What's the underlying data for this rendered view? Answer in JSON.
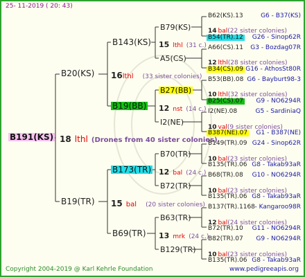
{
  "header": {
    "date": "25- 11-2019 ( 20: 43)"
  },
  "footer": {
    "copyright": "Copyright 2004-2019 @ Karl Kehrle Foundation",
    "site": "www.pedigreeapis.org"
  },
  "colors": {
    "border": "#2ea52e",
    "background": "#fefef0",
    "pink": "#f9c3f2",
    "green": "#12c212",
    "yellow": "#ffff00",
    "cyan": "#22dde8"
  },
  "gen1": {
    "name": "B191(KS)"
  },
  "gen1_mate": {
    "num": "18",
    "abbr": "lthl",
    "note": "(Drones from 40 sister colonies)"
  },
  "gen2": [
    {
      "name": "B20(KS)",
      "num": "16",
      "abbr": "lthl",
      "note": "(33 sister colonies)"
    },
    {
      "name": "B19(TR)",
      "num": "15",
      "abbr": "bal",
      "note": "(20 sister colonies)"
    }
  ],
  "gen3": [
    {
      "name": "B143(KS)",
      "num": "15",
      "abbr": "lthl",
      "note": "(31 c.)"
    },
    {
      "name": "B19(BB)",
      "num": "12",
      "abbr": "nst",
      "note": "(14 c.)"
    },
    {
      "name": "B173(TR)",
      "num": "12",
      "abbr": "bal",
      "note": "(24 c.)"
    },
    {
      "name": "B69(TR)",
      "num": "13",
      "abbr": "mrk",
      "note": "(24 c.)"
    }
  ],
  "gen4": [
    {
      "name": "B79(KS)"
    },
    {
      "name": "A5(CS)"
    },
    {
      "name": "B27(BB)"
    },
    {
      "name": "I2(NE)"
    },
    {
      "name": "B70(TR)"
    },
    {
      "name": "B72(TR)"
    },
    {
      "name": "B63(TR)"
    },
    {
      "name": "B129(TR)"
    }
  ],
  "gen5": [
    {
      "name": "B62(KS).13",
      "code": "G6 - B37(KS)"
    },
    {
      "num": "14",
      "abbr": "bal",
      "note": "(22 sister colonies)"
    },
    {
      "name": "B54(TR).12",
      "code": "G26 - Sinop62R"
    },
    {
      "name": "A66(CS).11",
      "code": "G3 - Bozdag07R"
    },
    {
      "num": "12",
      "abbr": "lthl",
      "note": "(28 sister colonies)"
    },
    {
      "name": "B34(CS).09",
      "code": "G16 - AthosSt80R"
    },
    {
      "name": "B53(BB).08",
      "code": "G6 - Bayburt98-3"
    },
    {
      "num": "10",
      "abbr": "lthl",
      "note": "(32 sister colonies)"
    },
    {
      "name": "B25(CS).07",
      "code": "G9 - NO6294R"
    },
    {
      "name": "I2(NE).08",
      "code": "G5 - SardiniaQ"
    },
    {
      "num": "10",
      "abbr": "val",
      "note": "(9 sister colonies)"
    },
    {
      "name": "B387(NE).07",
      "code": "G1 - B387(NE)"
    },
    {
      "name": "B149(TR).09",
      "code": "G24 - Sinop62R"
    },
    {
      "num": "10",
      "abbr": "bal",
      "note": "(23 sister colonies)"
    },
    {
      "name": "B135(TR).06",
      "code": "G8 - Takab93aR"
    },
    {
      "name": "B68(TR).08",
      "code": "G10 - NO6294R"
    },
    {
      "num": "10",
      "abbr": "bal",
      "note": "(23 sister colonies)"
    },
    {
      "name": "B135(TR).06",
      "code": "G8 - Takab93aR"
    },
    {
      "name": "B137(TR).1168",
      "code": "- Kangaroo98R"
    },
    {
      "num": "12",
      "abbr": "bal",
      "note": "(24 sister colonies)"
    },
    {
      "name": "B72(TR).10",
      "code": "G11 - NO6294R"
    },
    {
      "name": "B82(TR).07",
      "code": "G9 - NO6294R"
    },
    {
      "num": "10",
      "abbr": "bal",
      "note": "(23 sister colonies)"
    },
    {
      "name": "B135(TR).06",
      "code": "G8 - Takab93aR"
    }
  ]
}
